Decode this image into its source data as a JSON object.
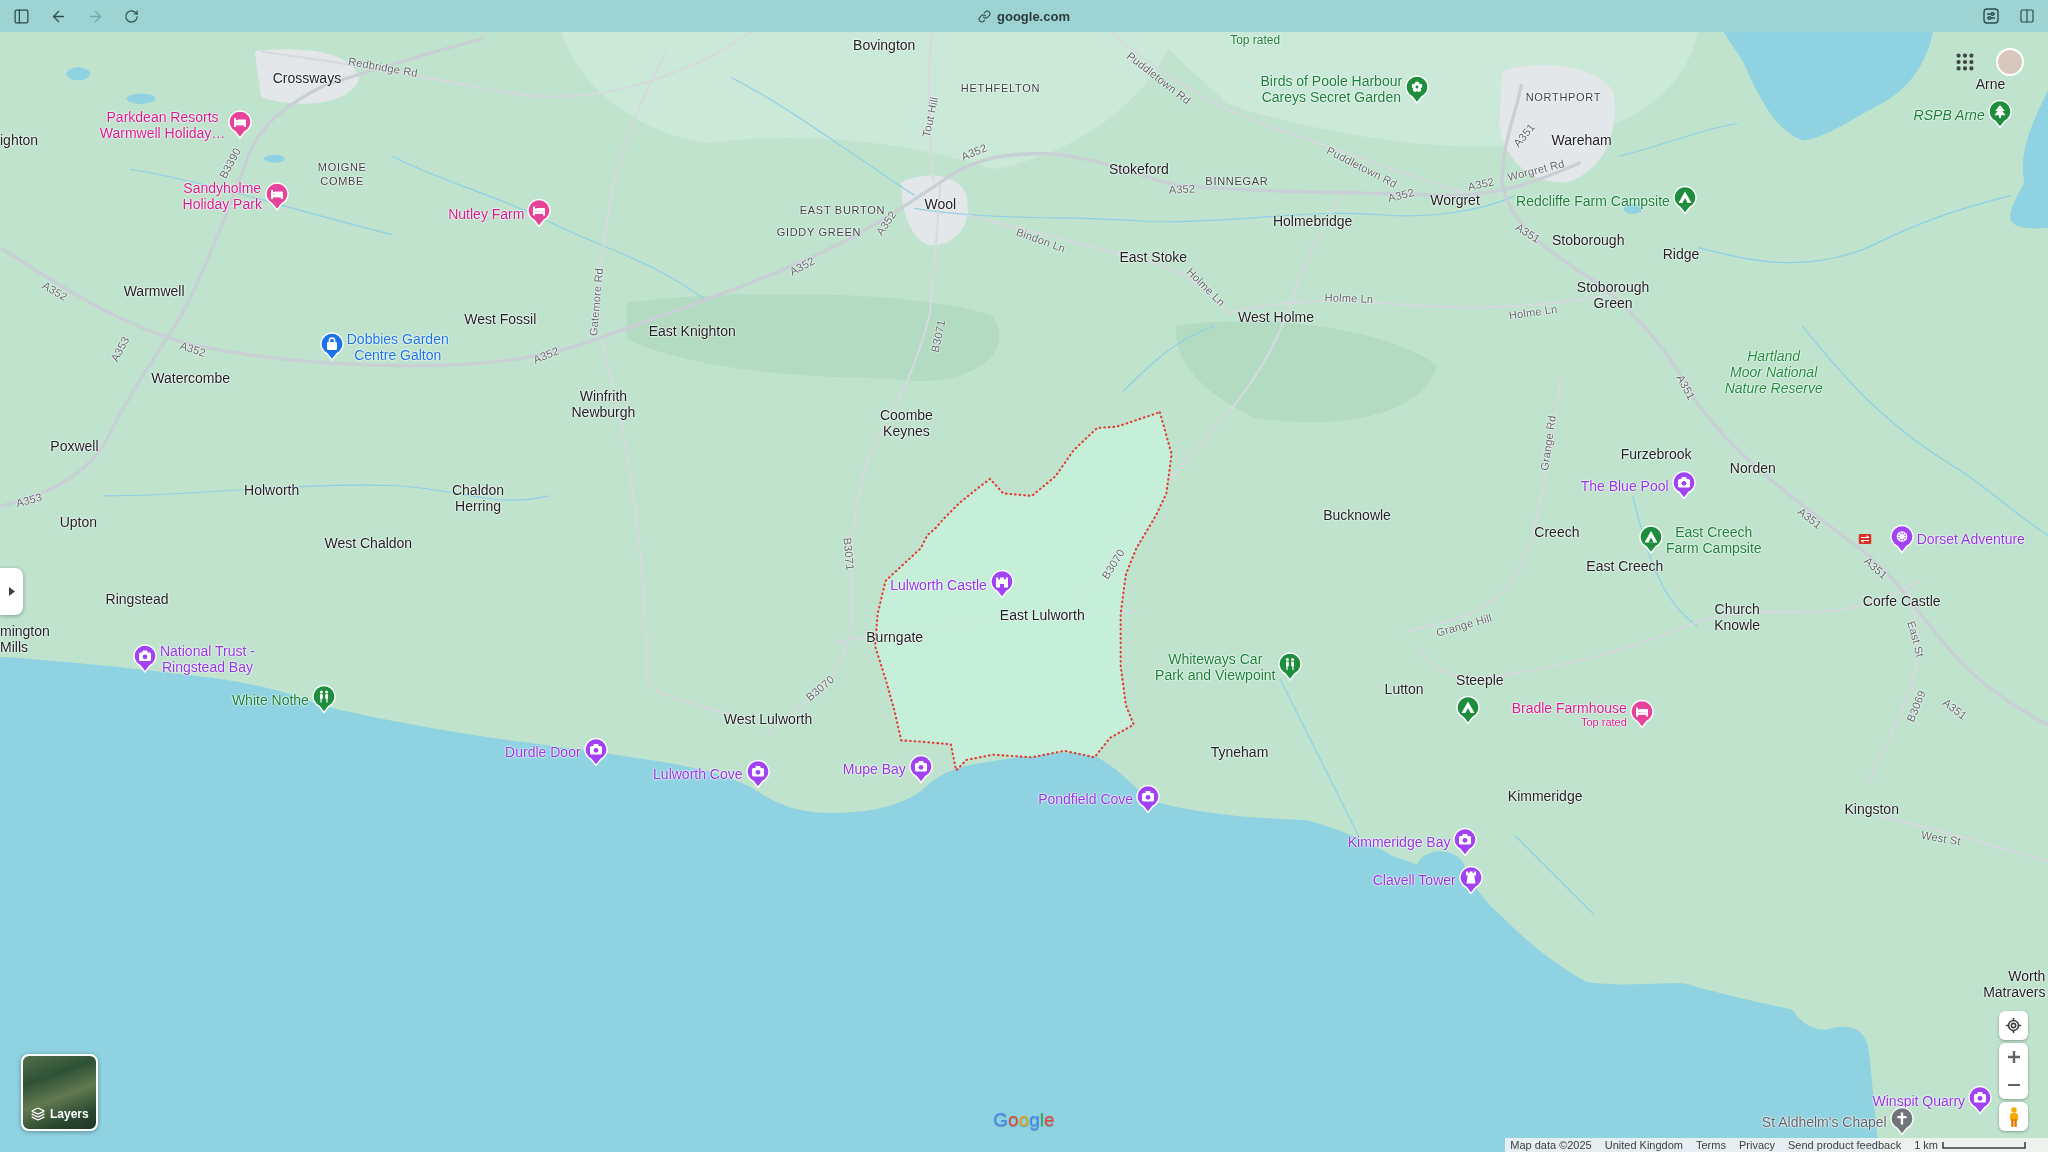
{
  "browser": {
    "address": "google.com",
    "back": {
      "disabled": false
    },
    "forward": {
      "disabled": true
    }
  },
  "map": {
    "places": [
      {
        "lines": [
          "Bovington"
        ],
        "kind": "town"
      },
      {
        "lines": [
          "Top rated"
        ],
        "kind": "note"
      },
      {
        "lines": [
          "Crossways"
        ],
        "kind": "town"
      },
      {
        "lines": [
          "HETHFELTON"
        ],
        "kind": "district"
      },
      {
        "lines": [
          "NORTHPORT"
        ],
        "kind": "district"
      },
      {
        "lines": [
          "Arne"
        ],
        "kind": "town"
      },
      {
        "lines": [
          "ighton"
        ],
        "kind": "town"
      },
      {
        "lines": [
          "Wareham"
        ],
        "kind": "town"
      },
      {
        "lines": [
          "MOIGNE",
          "COMBE"
        ],
        "kind": "district"
      },
      {
        "lines": [
          "Stokeford"
        ],
        "kind": "town"
      },
      {
        "lines": [
          "BINNEGAR"
        ],
        "kind": "district"
      },
      {
        "lines": [
          "EAST BURTON"
        ],
        "kind": "district"
      },
      {
        "lines": [
          "Wool"
        ],
        "kind": "town"
      },
      {
        "lines": [
          "Worgret"
        ],
        "kind": "town"
      },
      {
        "lines": [
          "GIDDY GREEN"
        ],
        "kind": "district"
      },
      {
        "lines": [
          "Holmebridge"
        ],
        "kind": "town"
      },
      {
        "lines": [
          "Stoborough"
        ],
        "kind": "town"
      },
      {
        "lines": [
          "East Stoke"
        ],
        "kind": "town"
      },
      {
        "lines": [
          "Ridge"
        ],
        "kind": "town"
      },
      {
        "lines": [
          "Warmwell"
        ],
        "kind": "town"
      },
      {
        "lines": [
          "West Fossil"
        ],
        "kind": "town"
      },
      {
        "lines": [
          "East Knighton"
        ],
        "kind": "town"
      },
      {
        "lines": [
          "West Holme"
        ],
        "kind": "town"
      },
      {
        "lines": [
          "Stoborough",
          "Green"
        ],
        "kind": "town"
      },
      {
        "lines": [
          "Watercombe"
        ],
        "kind": "town"
      },
      {
        "lines": [
          "Winfrith",
          "Newburgh"
        ],
        "kind": "town"
      },
      {
        "lines": [
          "Hartland",
          "Moor National",
          "Nature Reserve"
        ],
        "kind": "nature"
      },
      {
        "lines": [
          "Coombe",
          "Keynes"
        ],
        "kind": "town"
      },
      {
        "lines": [
          "Poxwell"
        ],
        "kind": "town"
      },
      {
        "lines": [
          "Furzebrook"
        ],
        "kind": "town"
      },
      {
        "lines": [
          "Norden"
        ],
        "kind": "town"
      },
      {
        "lines": [
          "Holworth"
        ],
        "kind": "town"
      },
      {
        "lines": [
          "Upton"
        ],
        "kind": "town"
      },
      {
        "lines": [
          "Chaldon",
          "Herring"
        ],
        "kind": "town"
      },
      {
        "lines": [
          "Bucknowle"
        ],
        "kind": "town"
      },
      {
        "lines": [
          "West Chaldon"
        ],
        "kind": "town"
      },
      {
        "lines": [
          "Creech"
        ],
        "kind": "town"
      },
      {
        "lines": [
          "East Creech"
        ],
        "kind": "town"
      },
      {
        "lines": [
          "mington",
          "Mills"
        ],
        "kind": "town"
      },
      {
        "lines": [
          "Ringstead"
        ],
        "kind": "town"
      },
      {
        "lines": [
          "Burngate"
        ],
        "kind": "town"
      },
      {
        "lines": [
          "East Lulworth"
        ],
        "kind": "town"
      },
      {
        "lines": [
          "Church",
          "Knowle"
        ],
        "kind": "town"
      },
      {
        "lines": [
          "Corfe Castle"
        ],
        "kind": "town"
      },
      {
        "lines": [
          "Lutton"
        ],
        "kind": "town"
      },
      {
        "lines": [
          "Steeple"
        ],
        "kind": "town"
      },
      {
        "lines": [
          "West Lulworth"
        ],
        "kind": "town"
      },
      {
        "lines": [
          "Tyneham"
        ],
        "kind": "town"
      },
      {
        "lines": [
          "Kimmeridge"
        ],
        "kind": "town"
      },
      {
        "lines": [
          "Kingston"
        ],
        "kind": "town"
      },
      {
        "lines": [
          "Worth",
          "Matravers"
        ],
        "kind": "town"
      }
    ],
    "road_labels": [
      "Redbridge Rd",
      "B3390",
      "Tout Hill",
      "A352",
      "Puddletown Rd",
      "A352",
      "Puddletown Rd",
      "A352",
      "A352",
      "A351",
      "Worgret Rd",
      "A352",
      "Bindon Ln",
      "A351",
      "A352",
      "Gatemore Rd",
      "A352",
      "Holme Ln",
      "Holme Ln",
      "Holme Ln",
      "A353",
      "A352",
      "A352",
      "B3071",
      "A351",
      "Grange Rd",
      "A353",
      "A351",
      "B3071",
      "B3070",
      "A351",
      "Grange Hill",
      "East St",
      "B3070",
      "B3069",
      "A351",
      "West St"
    ],
    "pois": [
      {
        "lines": [
          "Birds of Poole Harbour",
          "Careys Secret Garden"
        ],
        "kind": "garden"
      },
      {
        "lines": [
          "Parkdean Resorts",
          "Warmwell Holiday…"
        ],
        "kind": "lodging"
      },
      {
        "lines": [
          "RSPB Arne"
        ],
        "kind": "reserve"
      },
      {
        "lines": [
          "Sandyholme",
          "Holiday Park"
        ],
        "kind": "lodging"
      },
      {
        "lines": [
          "Nutley Farm"
        ],
        "kind": "lodging"
      },
      {
        "lines": [
          "Redcliffe Farm Campsite"
        ],
        "kind": "campsite"
      },
      {
        "lines": [
          "Dobbies Garden",
          "Centre Galton"
        ],
        "kind": "shop"
      },
      {
        "lines": [
          "The Blue Pool"
        ],
        "kind": "attraction"
      },
      {
        "lines": [
          "East Creech",
          "Farm Campsite"
        ],
        "kind": "campsite"
      },
      {
        "lines": [
          "Dorset Adventure"
        ],
        "kind": "amusement"
      },
      {
        "lines": [
          "Lulworth Castle"
        ],
        "kind": "castle"
      },
      {
        "lines": [
          "National Trust -",
          "Ringstead Bay"
        ],
        "kind": "attraction"
      },
      {
        "lines": [
          "Whiteways Car",
          "Park and Viewpoint"
        ],
        "kind": "hiking"
      },
      {
        "lines": [
          "White Nothe"
        ],
        "kind": "hiking"
      },
      {
        "kind": "campsite"
      },
      {
        "lines": [
          "Bradle Farmhouse"
        ],
        "note": "Top rated",
        "kind": "lodging"
      },
      {
        "lines": [
          "Durdle Door"
        ],
        "kind": "attraction"
      },
      {
        "lines": [
          "Lulworth Cove"
        ],
        "kind": "attraction"
      },
      {
        "lines": [
          "Mupe Bay"
        ],
        "kind": "attraction"
      },
      {
        "lines": [
          "Pondfield Cove"
        ],
        "kind": "attraction"
      },
      {
        "lines": [
          "Kimmeridge Bay"
        ],
        "kind": "attraction"
      },
      {
        "lines": [
          "Clavell Tower"
        ],
        "kind": "tower"
      },
      {
        "lines": [
          "Winspit Quarry"
        ],
        "kind": "attraction"
      },
      {
        "lines": [
          "St Aldhelm's Chapel"
        ],
        "kind": "chapel"
      }
    ]
  },
  "layers": {
    "label": "Layers"
  },
  "logo": "Google",
  "footer": {
    "items": [
      "Map data ©2025",
      "United Kingdom",
      "Terms",
      "Privacy",
      "Send product feedback"
    ],
    "scale": "1 km"
  }
}
